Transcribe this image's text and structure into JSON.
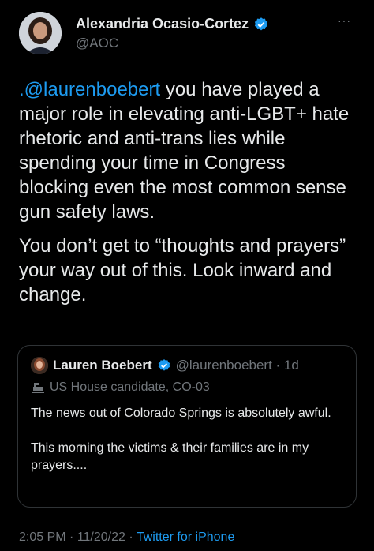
{
  "author": {
    "name": "Alexandria Ocasio-Cortez",
    "handle": "@AOC"
  },
  "more_label": "···",
  "tweet": {
    "mention": ".@laurenboebert",
    "paragraph1_rest": " you have played a major role in elevating anti-LGBT+ hate rhetoric and anti-trans lies while spending your time in Congress blocking even the most common sense gun safety laws.",
    "paragraph2": "You don’t get to “thoughts and prayers” your way out of this. Look inward and change."
  },
  "quoted": {
    "name": "Lauren Boebert",
    "handle": "@laurenboebert",
    "separator": " · ",
    "time": "1d",
    "label": "US House candidate, CO-03",
    "paragraph1": "The news out of Colorado Springs is absolutely awful.",
    "paragraph2": "This morning the victims & their families are in my prayers...."
  },
  "footer": {
    "time": "2:05 PM",
    "sep1": " · ",
    "date": "11/20/22",
    "sep2": " · ",
    "source": "Twitter for iPhone"
  },
  "colors": {
    "background": "#000000",
    "text": "#e7e9ea",
    "muted": "#71767b",
    "accent": "#1d9bf0",
    "border": "#2f3336"
  }
}
